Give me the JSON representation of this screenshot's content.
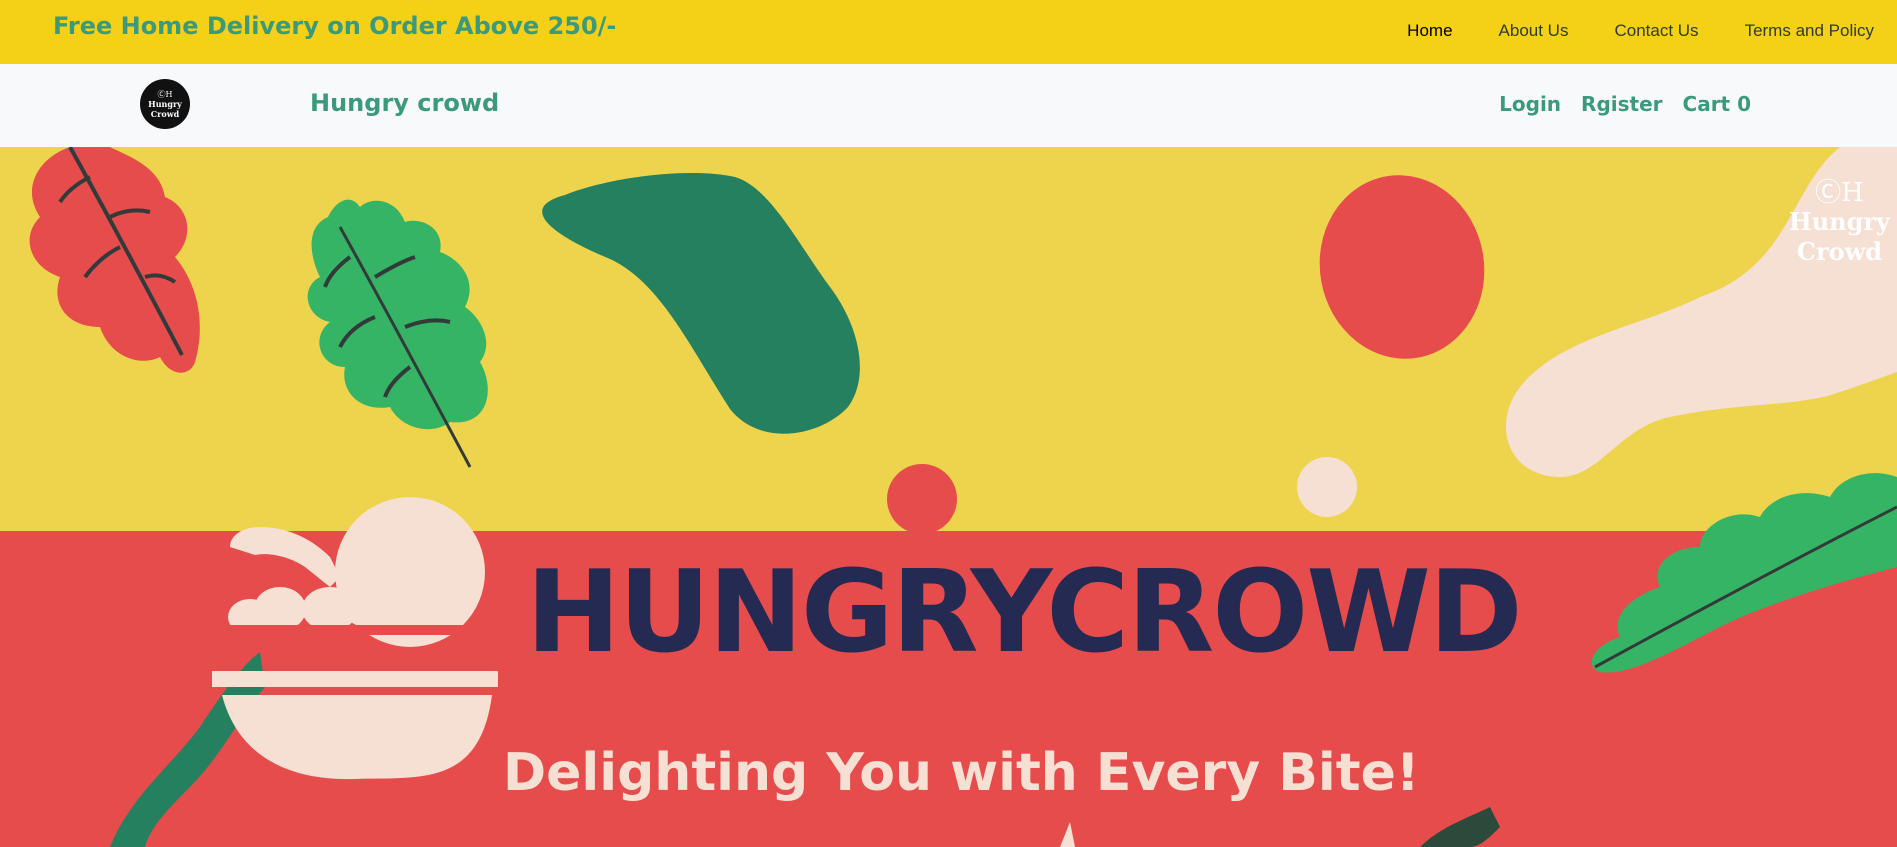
{
  "topbar": {
    "promo": "Free Home Delivery on Order Above 250/-",
    "links": [
      "Home",
      "About Us",
      "Contact Us",
      "Terms and Policy"
    ]
  },
  "navbar": {
    "logo": {
      "monogram": "ⒸH",
      "line1": "Hungry",
      "line2": "Crowd"
    },
    "brand": "Hungry crowd",
    "links": {
      "login": "Login",
      "register": "Rgister",
      "cart": "Cart 0"
    }
  },
  "hero": {
    "title": "HUNGRYCROWD",
    "tagline": "Delighting You with Every Bite!",
    "corner_logo": {
      "monogram": "ⒸH",
      "line1": "Hungry",
      "line2": "Crowd"
    },
    "icon": "salad-bowl-icon"
  },
  "colors": {
    "topbar_bg": "#f4d017",
    "accent_green": "#3b9a7c",
    "hero_yellow": "#eed34c",
    "hero_red": "#e54c4b",
    "title_navy": "#252a52",
    "cream": "#f6dfd3"
  }
}
